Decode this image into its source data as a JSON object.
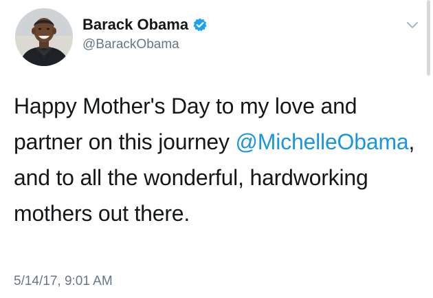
{
  "author": {
    "display_name": "Barack Obama",
    "handle": "@BarackObama",
    "verified": true,
    "avatar_icon": "profile-photo"
  },
  "tweet": {
    "text_before": "Happy Mother's Day to my love and partner on this journey ",
    "mention": "@MichelleObama",
    "text_after": ", and to all the wonderful, hardworking mothers out there.",
    "timestamp": "5/14/17, 9:01 AM"
  },
  "icons": {
    "verified": "verified-badge-icon",
    "menu": "chevron-down-icon"
  },
  "colors": {
    "link": "#1b95e0",
    "verified_badge": "#1da1f2",
    "secondary_text": "#657786",
    "primary_text": "#14171a"
  }
}
